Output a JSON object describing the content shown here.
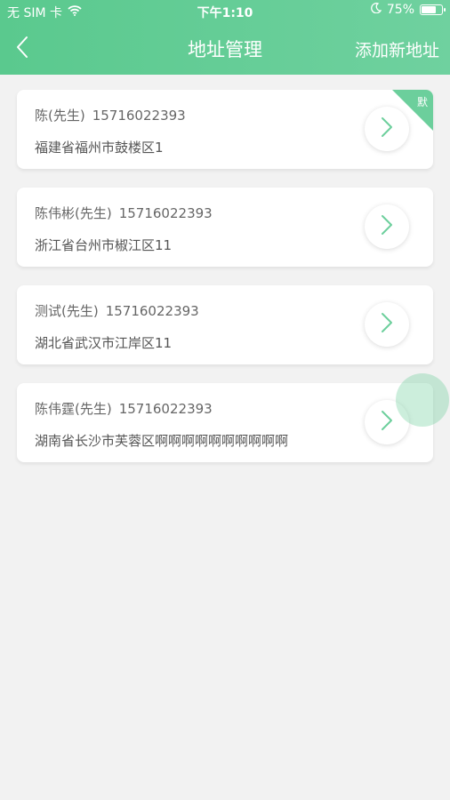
{
  "status_bar": {
    "carrier": "无 SIM 卡",
    "time": "下午1:10",
    "battery_text": "75%",
    "battery_level": 0.75
  },
  "nav": {
    "title": "地址管理",
    "action": "添加新地址"
  },
  "default_badge": "默",
  "addresses": [
    {
      "name": "陈(先生)",
      "phone": "15716022393",
      "address": "福建省福州市鼓楼区1",
      "is_default": true
    },
    {
      "name": "陈伟彬(先生)",
      "phone": "15716022393",
      "address": "浙江省台州市椒江区11",
      "is_default": false
    },
    {
      "name": "测试(先生)",
      "phone": "15716022393",
      "address": "湖北省武汉市江岸区11",
      "is_default": false
    },
    {
      "name": "陈伟霆(先生)",
      "phone": "15716022393",
      "address": "湖南省长沙市芙蓉区啊啊啊啊啊啊啊啊啊啊",
      "is_default": false
    }
  ],
  "colors": {
    "header": "#5ac98e",
    "accent": "#6ccf9c",
    "background": "#f2f2f2"
  },
  "icons": [
    "wifi-icon",
    "moon-icon",
    "battery-icon",
    "back-icon",
    "chevron-right-icon"
  ]
}
